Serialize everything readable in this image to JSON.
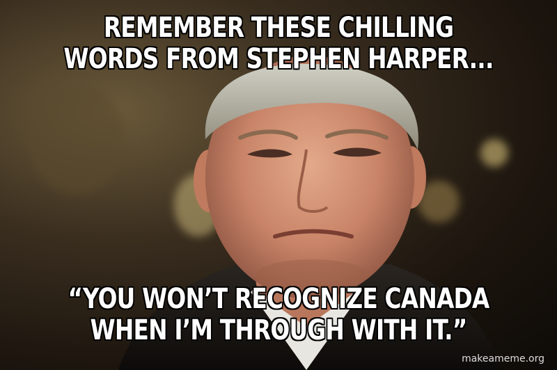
{
  "meme": {
    "top_text": {
      "line1": "REMEMBER THESE CHILLING",
      "line2": "WORDS FROM STEPHEN HARPER..."
    },
    "bottom_text": {
      "line1": "“YOU WON’T RECOGNIZE CANADA",
      "line2": "WHEN I’M THROUGH WITH IT.”"
    },
    "watermark": "makeameme.org"
  }
}
